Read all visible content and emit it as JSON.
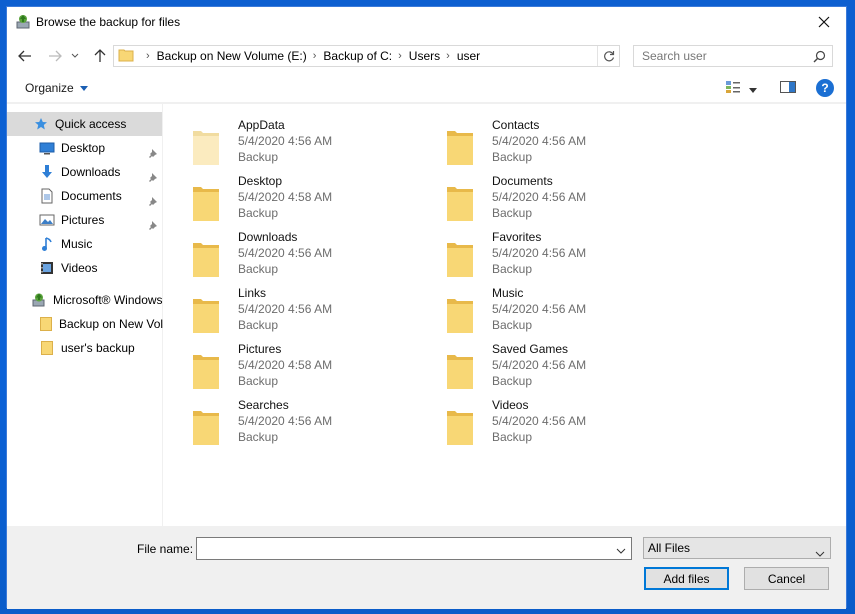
{
  "window": {
    "title": "Browse the backup for files"
  },
  "navigation": {
    "breadcrumbs": [
      "Backup on New Volume (E:)",
      "Backup of C:",
      "Users",
      "user"
    ],
    "search_placeholder": "Search user"
  },
  "toolbar": {
    "organize_label": "Organize"
  },
  "sidebar": {
    "quick_access": "Quick access",
    "pinned": [
      {
        "label": "Desktop",
        "icon": "desktop-icon"
      },
      {
        "label": "Downloads",
        "icon": "downloads-icon"
      },
      {
        "label": "Documents",
        "icon": "documents-icon"
      },
      {
        "label": "Pictures",
        "icon": "pictures-icon"
      }
    ],
    "other": [
      {
        "label": "Music",
        "icon": "music-icon"
      },
      {
        "label": "Videos",
        "icon": "videos-icon"
      }
    ],
    "backup_root": "Microsoft® Windows",
    "backup_items": [
      {
        "label": "Backup on New Vol"
      },
      {
        "label": "user's backup"
      }
    ]
  },
  "files": [
    {
      "name": "AppData",
      "date": "5/4/2020 4:56 AM",
      "type": "Backup",
      "faded": true
    },
    {
      "name": "Contacts",
      "date": "5/4/2020 4:56 AM",
      "type": "Backup",
      "faded": false
    },
    {
      "name": "Desktop",
      "date": "5/4/2020 4:58 AM",
      "type": "Backup",
      "faded": false
    },
    {
      "name": "Documents",
      "date": "5/4/2020 4:56 AM",
      "type": "Backup",
      "faded": false
    },
    {
      "name": "Downloads",
      "date": "5/4/2020 4:56 AM",
      "type": "Backup",
      "faded": false
    },
    {
      "name": "Favorites",
      "date": "5/4/2020 4:56 AM",
      "type": "Backup",
      "faded": false
    },
    {
      "name": "Links",
      "date": "5/4/2020 4:56 AM",
      "type": "Backup",
      "faded": false
    },
    {
      "name": "Music",
      "date": "5/4/2020 4:56 AM",
      "type": "Backup",
      "faded": false
    },
    {
      "name": "Pictures",
      "date": "5/4/2020 4:58 AM",
      "type": "Backup",
      "faded": false
    },
    {
      "name": "Saved Games",
      "date": "5/4/2020 4:56 AM",
      "type": "Backup",
      "faded": false
    },
    {
      "name": "Searches",
      "date": "5/4/2020 4:56 AM",
      "type": "Backup",
      "faded": false
    },
    {
      "name": "Videos",
      "date": "5/4/2020 4:56 AM",
      "type": "Backup",
      "faded": false
    }
  ],
  "footer": {
    "file_name_label": "File name:",
    "file_name_value": "",
    "filter_value": "All Files",
    "add_button": "Add files",
    "cancel_button": "Cancel"
  },
  "colors": {
    "folder": "#f8d775",
    "folder_dark": "#e8b94a",
    "accent": "#0078d7"
  }
}
